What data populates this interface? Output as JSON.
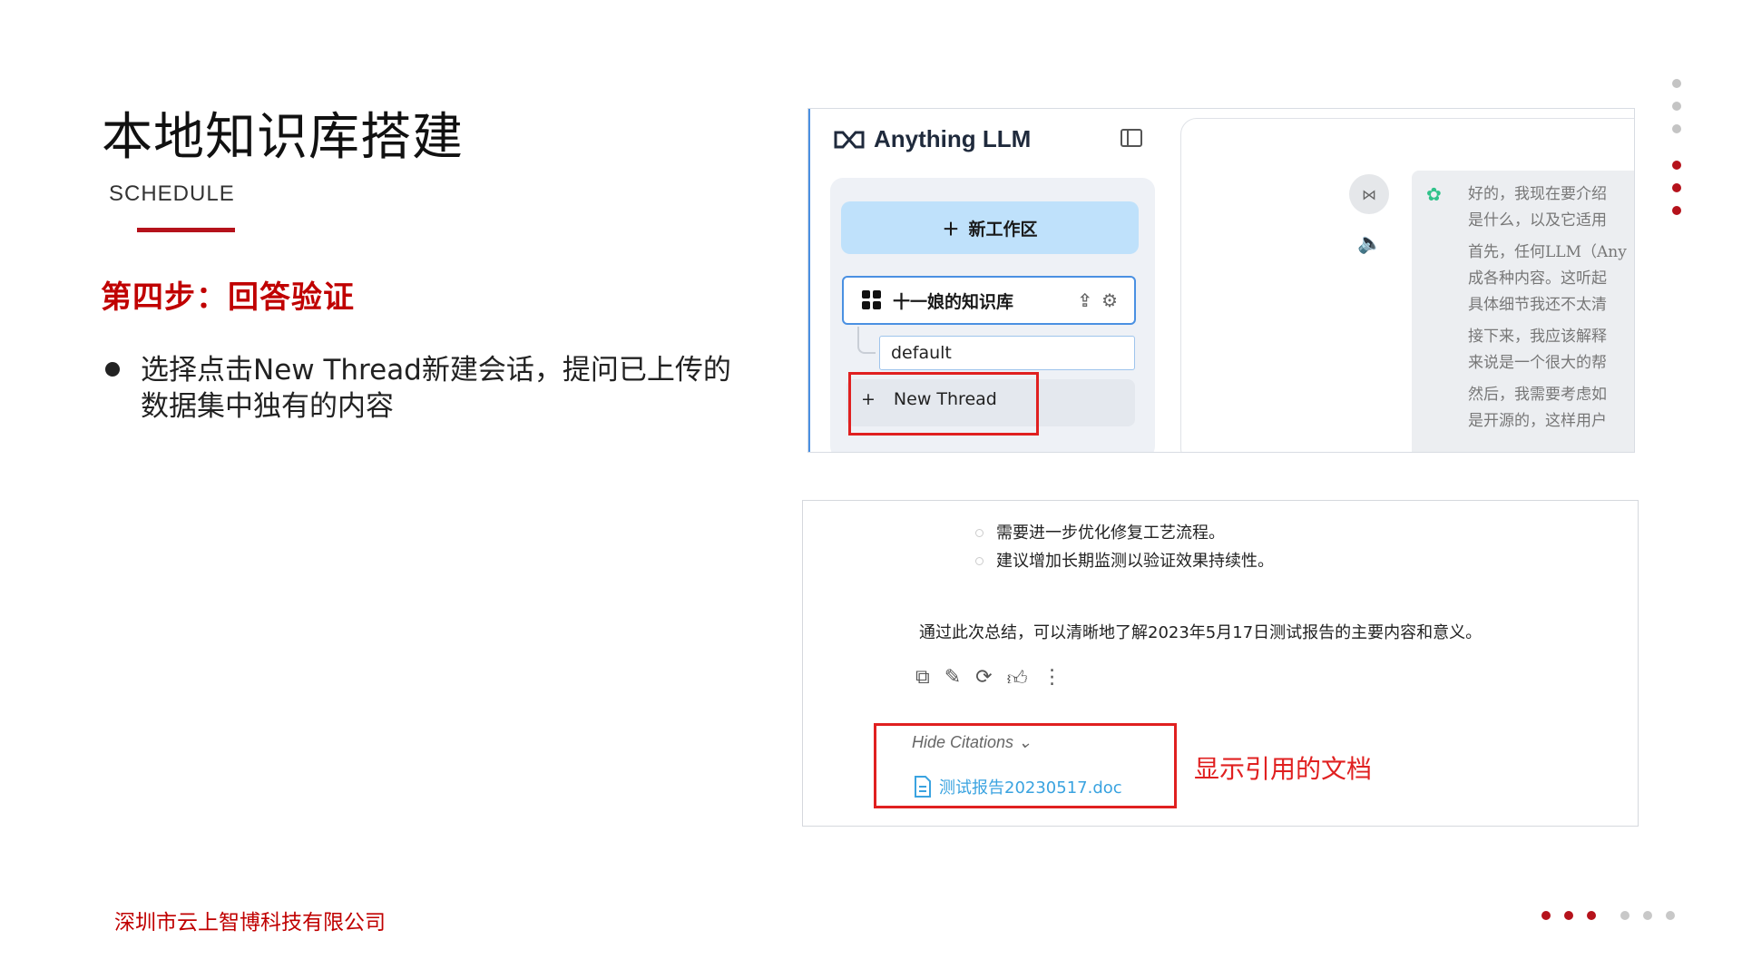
{
  "slide": {
    "title": "本地知识库搭建",
    "subtitle": "SCHEDULE",
    "step_title": "第四步：回答验证",
    "bullet": "选择点击New Thread新建会话，提问已上传的数据集中独有的内容",
    "company": "深圳市云上智博科技有限公司",
    "accent_color": "#b5121b"
  },
  "app_sidebar": {
    "app_name": "Anything LLM",
    "new_workspace_label": "新工作区",
    "workspace_name": "十一娘的知识库",
    "thread_default": "default",
    "new_thread_label": "New Thread"
  },
  "reply_preview": {
    "lines": [
      "好的，我现在要介绍",
      "是什么，以及它适用",
      "首先，任何LLM（Any",
      "成各种内容。这听起",
      "具体细节我还不太清",
      "接下来，我应该解释",
      "来说是一个很大的帮",
      "然后，我需要考虑如",
      "是开源的，这样用户"
    ]
  },
  "answer": {
    "bullet1": "需要进一步优化修复工艺流程。",
    "bullet2": "建议增加长期监测以验证效果持续性。",
    "summary": "通过此次总结，可以清晰地了解2023年5月17日测试报告的主要内容和意义。",
    "hide_citations": "Hide Citations",
    "citation_file": "测试报告20230517.doc",
    "annotation": "显示引用的文档"
  }
}
